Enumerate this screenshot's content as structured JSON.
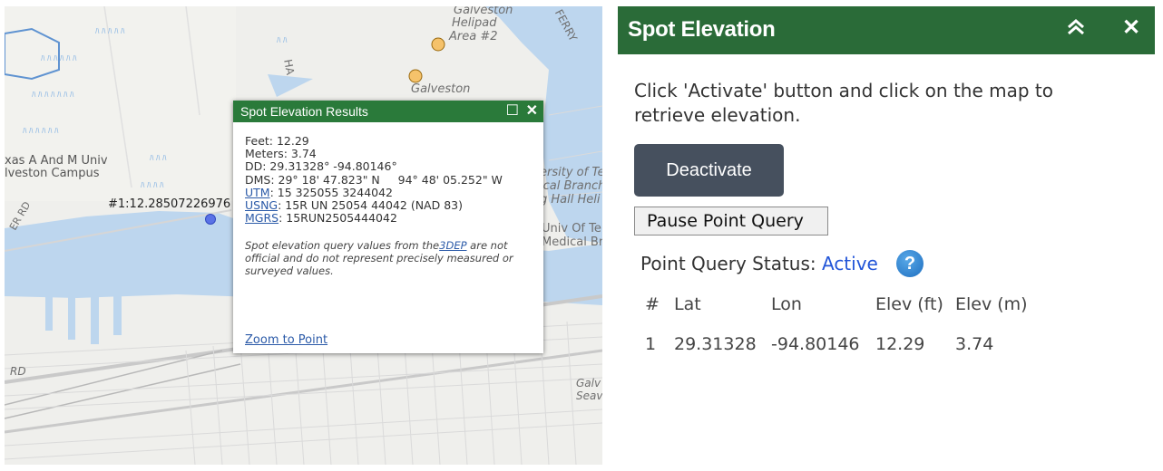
{
  "map": {
    "labels": {
      "galveston_top": "Galveston",
      "helipad": "Helipad",
      "area2": "Area #2",
      "galveston": "Galveston",
      "ferry": "FERRY",
      "tamu1": "xas A And M Univ",
      "tamu2": "lveston Campus",
      "rd_left": "ER RD",
      "point_label": "#1:12.28507226976",
      "utmb1": "ersity of Te",
      "utmb2": "ical Branch",
      "utmb3": "g Hall Heli",
      "utmb4": "Univ Of Te",
      "utmb5": "Medical Bra",
      "rd_bottom": "RD",
      "galv_right1": "Galv",
      "galv_right2": "Seav",
      "ha": "HA"
    },
    "popup": {
      "title": "Spot Elevation Results",
      "feet": "Feet: 12.29",
      "meters": "Meters: 3.74",
      "dd": "DD: 29.31328° -94.80146°",
      "dms": "DMS: 29° 18' 47.823\" N     94° 48' 05.252\" W",
      "utm_link": "UTM",
      "utm_value": ": 15 325055 3244042",
      "usng_link": "USNG",
      "usng_value": ": 15R UN 25054 44042 (NAD 83)",
      "mgrs_link": "MGRS",
      "mgrs_value": ": 15RUN2505444042",
      "disclaimer_pre": "Spot elevation query values from the",
      "disclaimer_link": "3DEP",
      "disclaimer_post": " are not official and do not represent precisely measured or surveyed values.",
      "zoom_link": "Zoom to Point"
    }
  },
  "panel": {
    "title": "Spot Elevation",
    "instructions": "Click 'Activate' button and click on the map to retrieve elevation.",
    "deactivate_label": "Deactivate",
    "pause_label": "Pause Point Query",
    "status_label": "Point Query Status:",
    "status_value": "Active",
    "help_glyph": "?",
    "table": {
      "headers": [
        "#",
        "Lat",
        "Lon",
        "Elev (ft)",
        "Elev (m)"
      ],
      "rows": [
        [
          "1",
          "29.31328",
          "-94.80146",
          "12.29",
          "3.74"
        ]
      ]
    }
  },
  "colors": {
    "header_green": "#2a6b38",
    "popup_green": "#2a7a3a",
    "status_blue": "#2255d8",
    "button_slate": "#46505e",
    "water": "#bdd6ee"
  }
}
